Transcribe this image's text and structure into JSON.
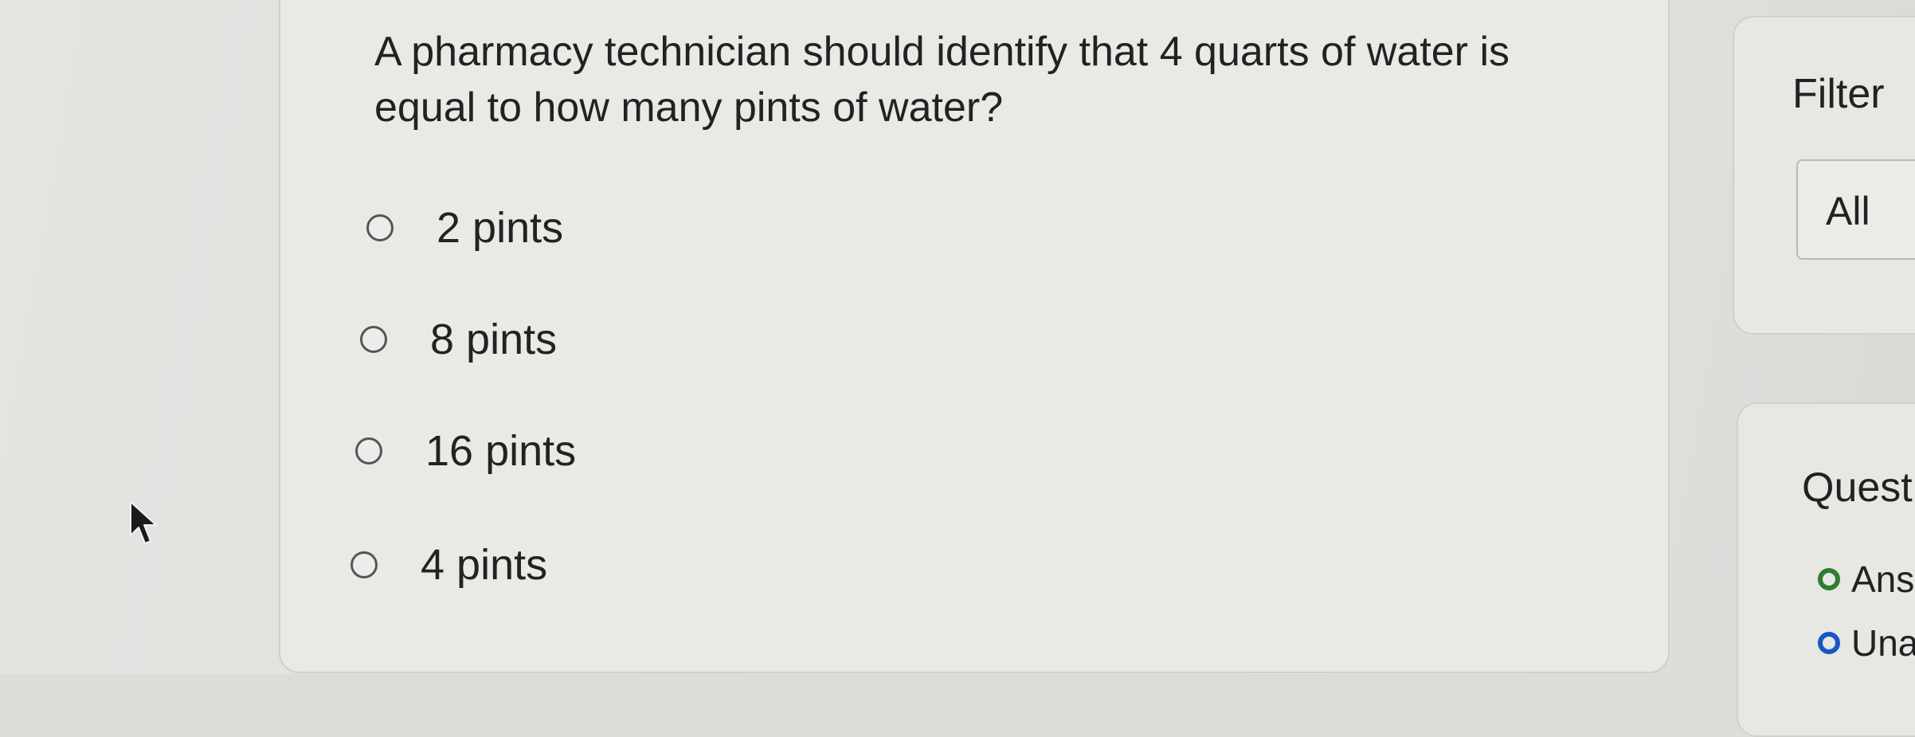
{
  "question": {
    "text": "A pharmacy technician should identify that 4 quarts of water is equal to how many pints of water?",
    "options": [
      {
        "label": "2 pints",
        "selected": false
      },
      {
        "label": "8 pints",
        "selected": false
      },
      {
        "label": "16 pints",
        "selected": false
      },
      {
        "label": "4 pints",
        "selected": false
      }
    ]
  },
  "filter": {
    "title": "Filter",
    "selected_value": "All"
  },
  "status": {
    "title": "Quest",
    "legend": [
      {
        "label": "Ans",
        "color": "#2e7d32"
      },
      {
        "label": "Una",
        "color": "#1a56c4"
      }
    ]
  },
  "icons": {
    "cursor": "mouse-pointer-icon",
    "radio": "radio-button-icon"
  }
}
